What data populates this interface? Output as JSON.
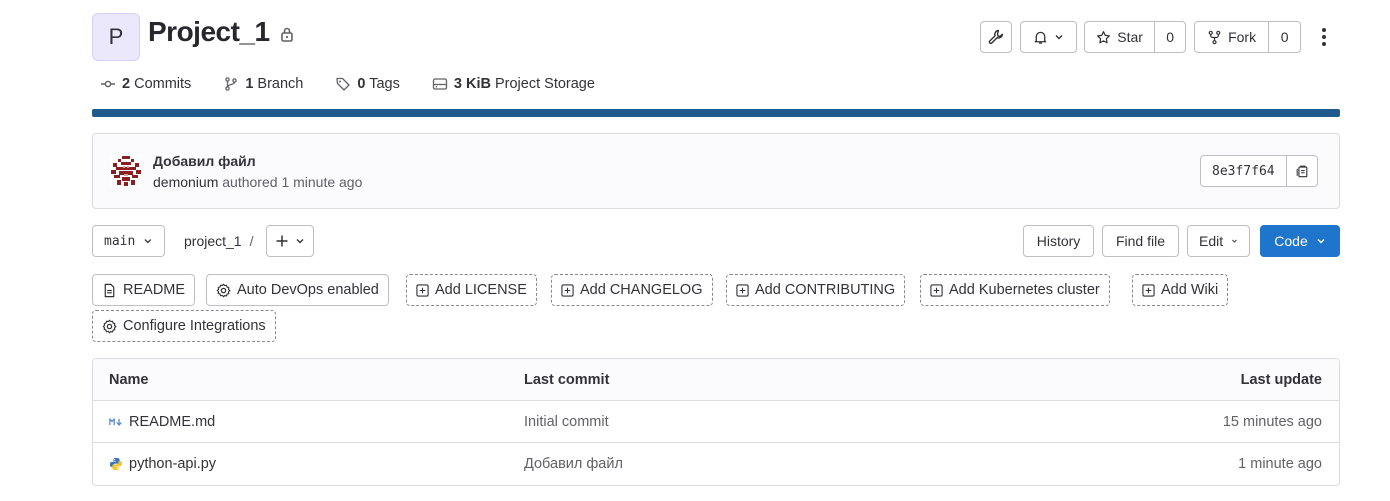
{
  "project": {
    "avatar_letter": "P",
    "name": "Project_1"
  },
  "header_buttons": {
    "star_label": "Star",
    "star_count": "0",
    "fork_label": "Fork",
    "fork_count": "0"
  },
  "stats": [
    {
      "icon": "commit-icon",
      "count": "2",
      "label": "Commits"
    },
    {
      "icon": "branch-icon",
      "count": "1",
      "label": "Branch"
    },
    {
      "icon": "tag-icon",
      "count": "0",
      "label": "Tags"
    },
    {
      "icon": "storage-icon",
      "count": "3 KiB",
      "label": "Project Storage"
    }
  ],
  "progress": {
    "fill_fraction": 1.0,
    "color": "#1f5a8c"
  },
  "last_commit": {
    "title": "Добавил файл",
    "author": "demonium",
    "action": "authored",
    "time": "1 minute ago",
    "sha": "8e3f7f64"
  },
  "toolbar": {
    "branch": "main",
    "path": "project_1",
    "path_sep": "/",
    "history": "History",
    "find_file": "Find file",
    "edit": "Edit",
    "code": "Code"
  },
  "quick_actions": [
    {
      "label": "README",
      "icon": "doc-icon",
      "style": "solid"
    },
    {
      "label": "Auto DevOps enabled",
      "icon": "gear-icon",
      "style": "solid"
    },
    {
      "label": "Add LICENSE",
      "icon": "plus-square-icon",
      "style": "dashed"
    },
    {
      "label": "Add CHANGELOG",
      "icon": "plus-square-icon",
      "style": "dashed"
    },
    {
      "label": "Add CONTRIBUTING",
      "icon": "plus-square-icon",
      "style": "dashed"
    },
    {
      "label": "Add Kubernetes cluster",
      "icon": "plus-square-icon",
      "style": "dashed"
    },
    {
      "label": "Add Wiki",
      "icon": "plus-square-icon",
      "style": "dashed"
    },
    {
      "label": "Configure Integrations",
      "icon": "gear-icon",
      "style": "dashed"
    }
  ],
  "table": {
    "headers": {
      "name": "Name",
      "last_commit": "Last commit",
      "last_update": "Last update"
    },
    "rows": [
      {
        "icon": "markdown-icon",
        "name": "README.md",
        "commit": "Initial commit",
        "updated": "15 minutes ago"
      },
      {
        "icon": "python-icon",
        "name": "python-api.py",
        "commit": "Добавил файл",
        "updated": "1 minute ago"
      }
    ]
  },
  "colors": {
    "primary": "#1f75cb",
    "text": "#333238",
    "muted": "#626168",
    "border": "#bfbfc3"
  }
}
